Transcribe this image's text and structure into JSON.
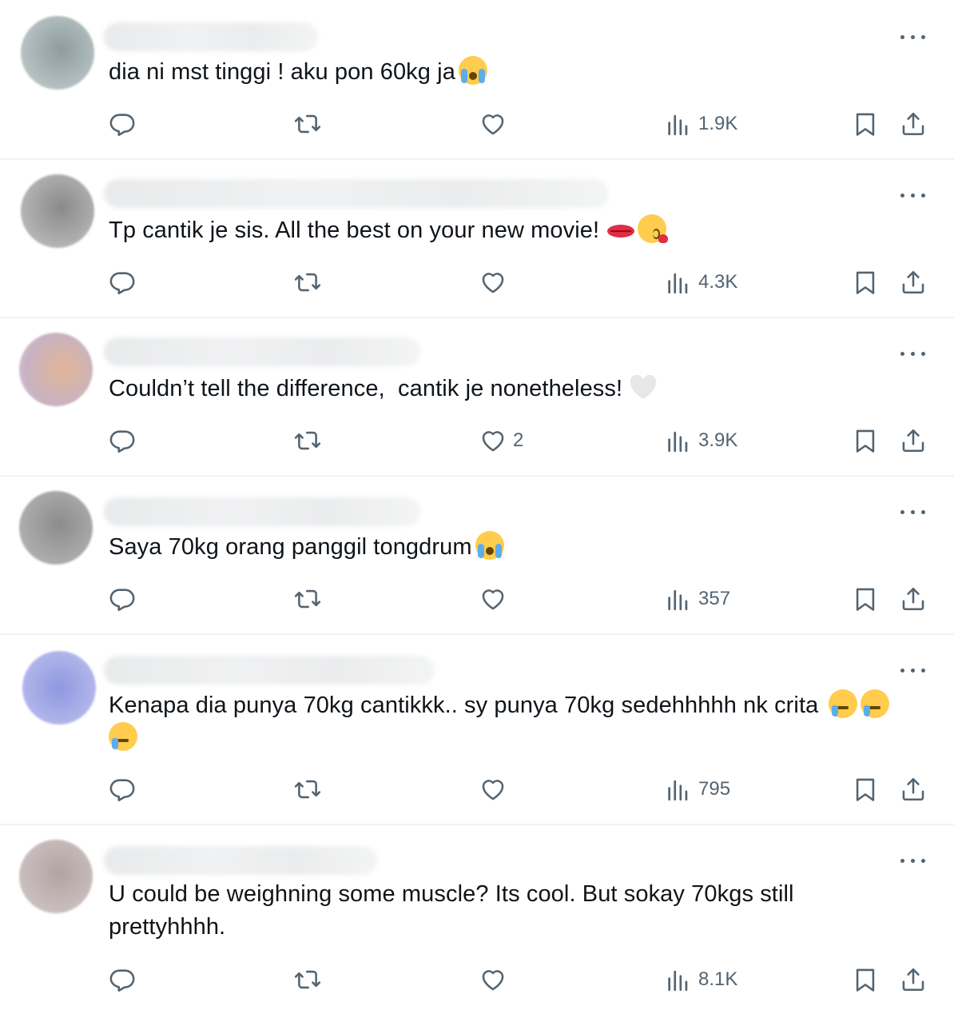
{
  "icons": {
    "reply": "reply-icon",
    "repost": "repost-icon",
    "like": "heart-icon",
    "views": "views-chart-icon",
    "bookmark": "bookmark-icon",
    "share": "share-icon",
    "more": "more-dots-icon"
  },
  "colors": {
    "text": "#0f1419",
    "icon": "#536471",
    "divider": "#eff3f4"
  },
  "tweets": [
    {
      "text": "dia ni mst tinggi ! aku pon 60kg ja",
      "emojis": [
        "loudly-crying-face"
      ],
      "likes": "",
      "views": "1.9K"
    },
    {
      "text": "Tp cantik je sis. All the best on your new movie!",
      "emojis": [
        "kiss-mark",
        "face-blowing-a-kiss"
      ],
      "likes": "",
      "views": "4.3K"
    },
    {
      "text": "Couldn’t tell the difference,  cantik je nonetheless!",
      "emojis": [
        "white-heart"
      ],
      "likes": "2",
      "views": "3.9K"
    },
    {
      "text": "Saya 70kg orang panggil tongdrum",
      "emojis": [
        "loudly-crying-face"
      ],
      "likes": "",
      "views": "357"
    },
    {
      "text": "Kenapa dia punya 70kg cantikkk.. sy punya 70kg sedehhhhh nk crita",
      "emojis": [
        "face-holding-back-tears",
        "face-holding-back-tears",
        "face-holding-back-tears"
      ],
      "likes": "",
      "views": "795"
    },
    {
      "text": "U could be weighning some muscle? Its cool. But sokay 70kgs still prettyhhhh.",
      "emojis": [],
      "likes": "",
      "views": "8.1K"
    }
  ]
}
